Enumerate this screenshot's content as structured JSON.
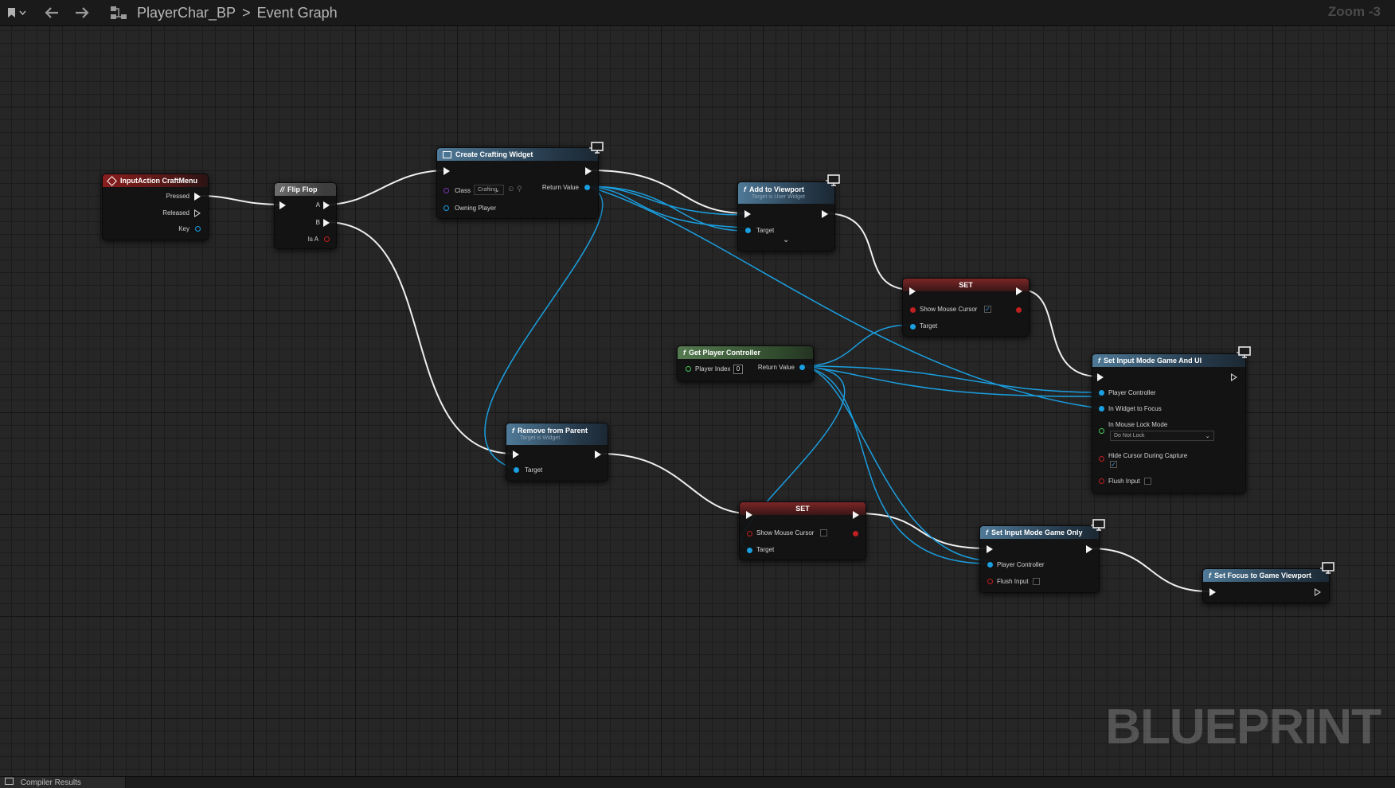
{
  "toolbar": {
    "bookmark_icon": "bookmark-icon",
    "breadcrumb_blueprint": "PlayerChar_BP",
    "breadcrumb_graph": "Event Graph",
    "zoom_text": "Zoom -3"
  },
  "watermark": "BLUEPRINT",
  "bottom": {
    "compiler_tab": "Compiler Results"
  },
  "colors": {
    "exec_wire": "#f0f0f0",
    "object_wire": "#1a9fe0",
    "event_header": "#8a1e1e",
    "function_header": "#4f7a98",
    "pure_header": "#557a50"
  },
  "nodes": {
    "input_action": {
      "title": "InputAction CraftMenu",
      "pins": {
        "pressed": "Pressed",
        "released": "Released",
        "key": "Key"
      }
    },
    "flip_flop": {
      "title": "Flip Flop",
      "pins": {
        "a": "A",
        "b": "B",
        "is_a": "Is A"
      }
    },
    "create_widget": {
      "title": "Create Crafting Widget",
      "pins": {
        "class": "Class",
        "class_value": "Crafting",
        "owning_player": "Owning Player",
        "return_value": "Return Value"
      }
    },
    "add_to_viewport": {
      "title": "Add to Viewport",
      "subtitle": "Target is User Widget",
      "pins": {
        "target": "Target"
      }
    },
    "set_show_cursor_1": {
      "title": "SET",
      "pins": {
        "show_mouse_cursor": "Show Mouse Cursor",
        "target": "Target"
      },
      "checked": true
    },
    "get_player_controller": {
      "title": "Get Player Controller",
      "pins": {
        "player_index": "Player Index",
        "player_index_value": "0",
        "return_value": "Return Value"
      }
    },
    "set_input_game_ui": {
      "title": "Set Input Mode Game And UI",
      "pins": {
        "player_controller": "Player Controller",
        "widget_to_focus": "In Widget to Focus",
        "mouse_lock_mode": "In Mouse Lock Mode",
        "mouse_lock_value": "Do Not Lock",
        "hide_cursor": "Hide Cursor During Capture",
        "flush_input": "Flush Input"
      },
      "hide_cursor_checked": true,
      "flush_input_checked": false
    },
    "remove_from_parent": {
      "title": "Remove from Parent",
      "subtitle": "Target is Widget",
      "pins": {
        "target": "Target"
      }
    },
    "set_show_cursor_2": {
      "title": "SET",
      "pins": {
        "show_mouse_cursor": "Show Mouse Cursor",
        "target": "Target"
      },
      "checked": false
    },
    "set_input_game_only": {
      "title": "Set Input Mode Game Only",
      "pins": {
        "player_controller": "Player Controller",
        "flush_input": "Flush Input"
      },
      "flush_input_checked": false
    },
    "set_focus_viewport": {
      "title": "Set Focus to Game Viewport"
    }
  }
}
